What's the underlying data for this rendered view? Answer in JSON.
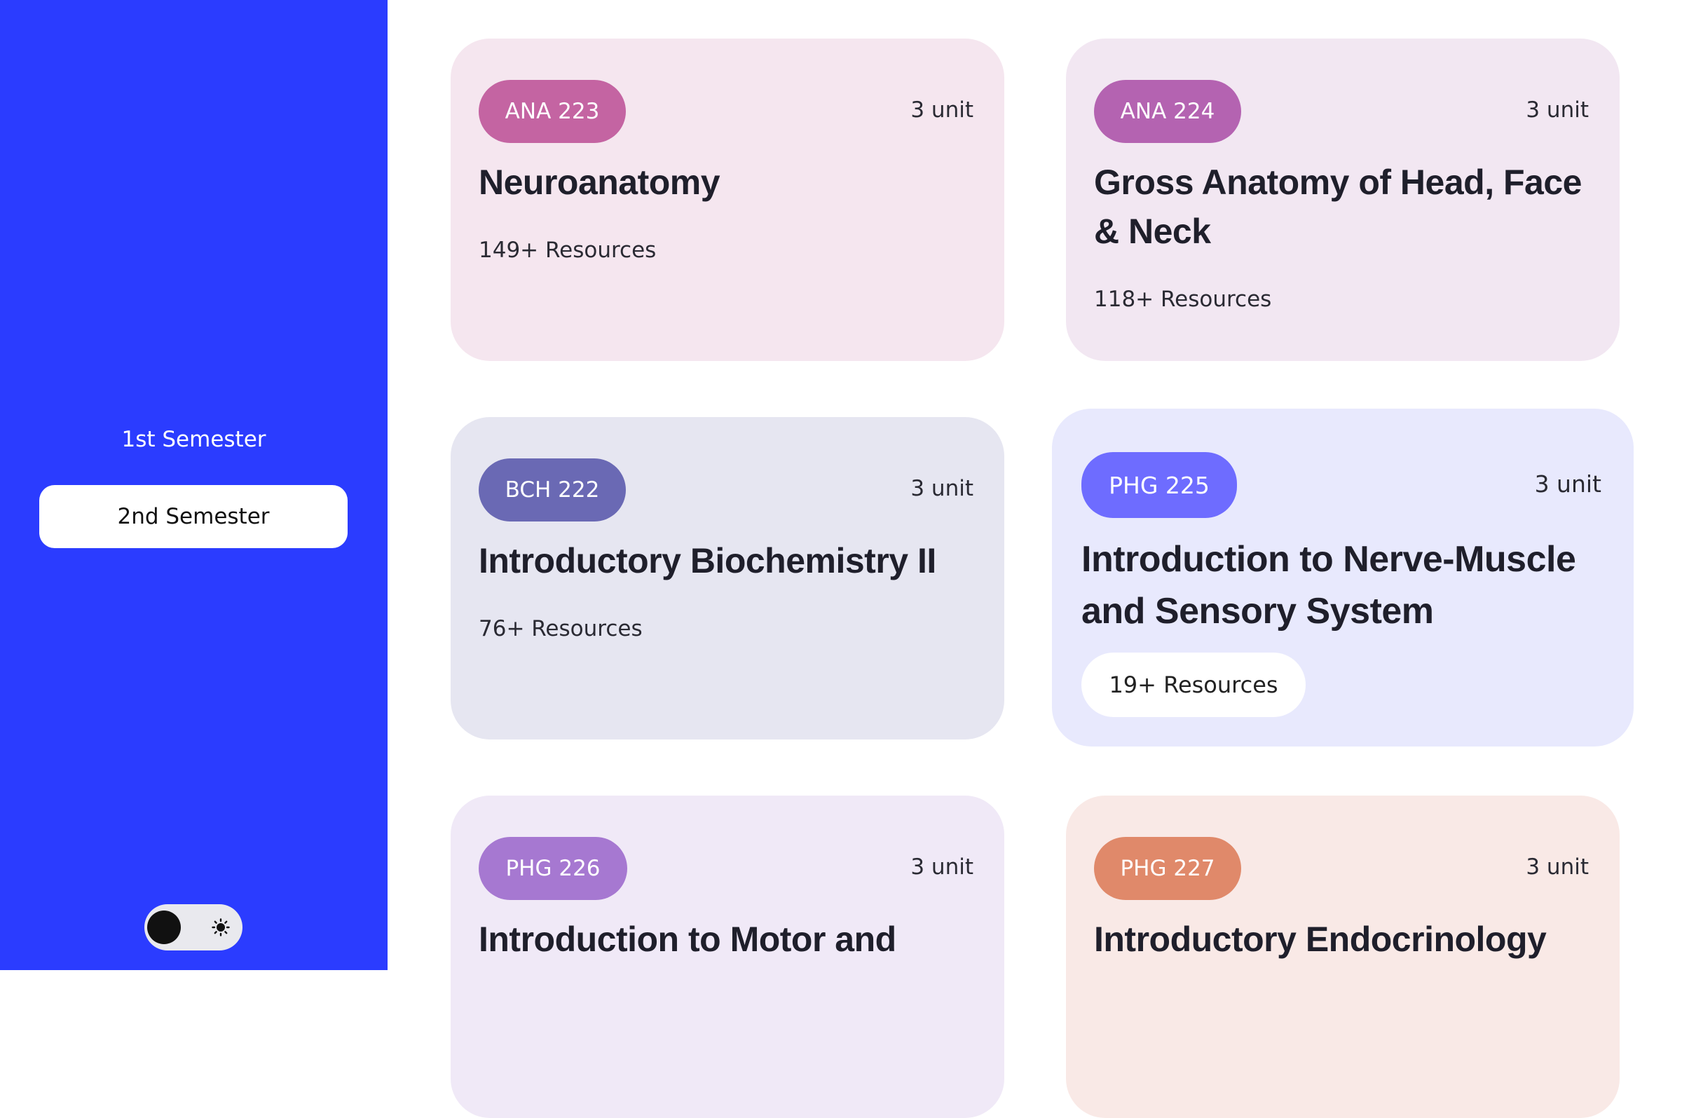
{
  "sidebar": {
    "semesters": [
      {
        "label": "1st Semester",
        "active": false
      },
      {
        "label": "2nd Semester",
        "active": true
      }
    ],
    "theme_toggle": {
      "icon": "sun-icon",
      "mode": "light"
    }
  },
  "colors": {
    "sidebar_bg": "#2b3cff",
    "ana223": "#c464a2",
    "ana224": "#b463b1",
    "bch222": "#6a69b4",
    "phg225": "#6e6cff",
    "phg226": "#a678d1",
    "phg227": "#e0896a"
  },
  "courses": [
    {
      "code": "ANA 223",
      "units": "3 unit",
      "title": "Neuroanatomy",
      "resources": "149+ Resources"
    },
    {
      "code": "ANA 224",
      "units": "3 unit",
      "title": "Gross Anatomy of Head, Face & Neck",
      "resources": "118+ Resources"
    },
    {
      "code": "BCH 222",
      "units": "3 unit",
      "title": "Introductory Biochemistry II",
      "resources": "76+ Resources"
    },
    {
      "code": "PHG 225",
      "units": "3 unit",
      "title": "Introduction to Nerve-Muscle and Sensory System",
      "resources": "19+ Resources"
    },
    {
      "code": "PHG 226",
      "units": "3 unit",
      "title": "Introduction to Motor and",
      "resources": ""
    },
    {
      "code": "PHG 227",
      "units": "3 unit",
      "title": "Introductory Endocrinology",
      "resources": ""
    }
  ]
}
